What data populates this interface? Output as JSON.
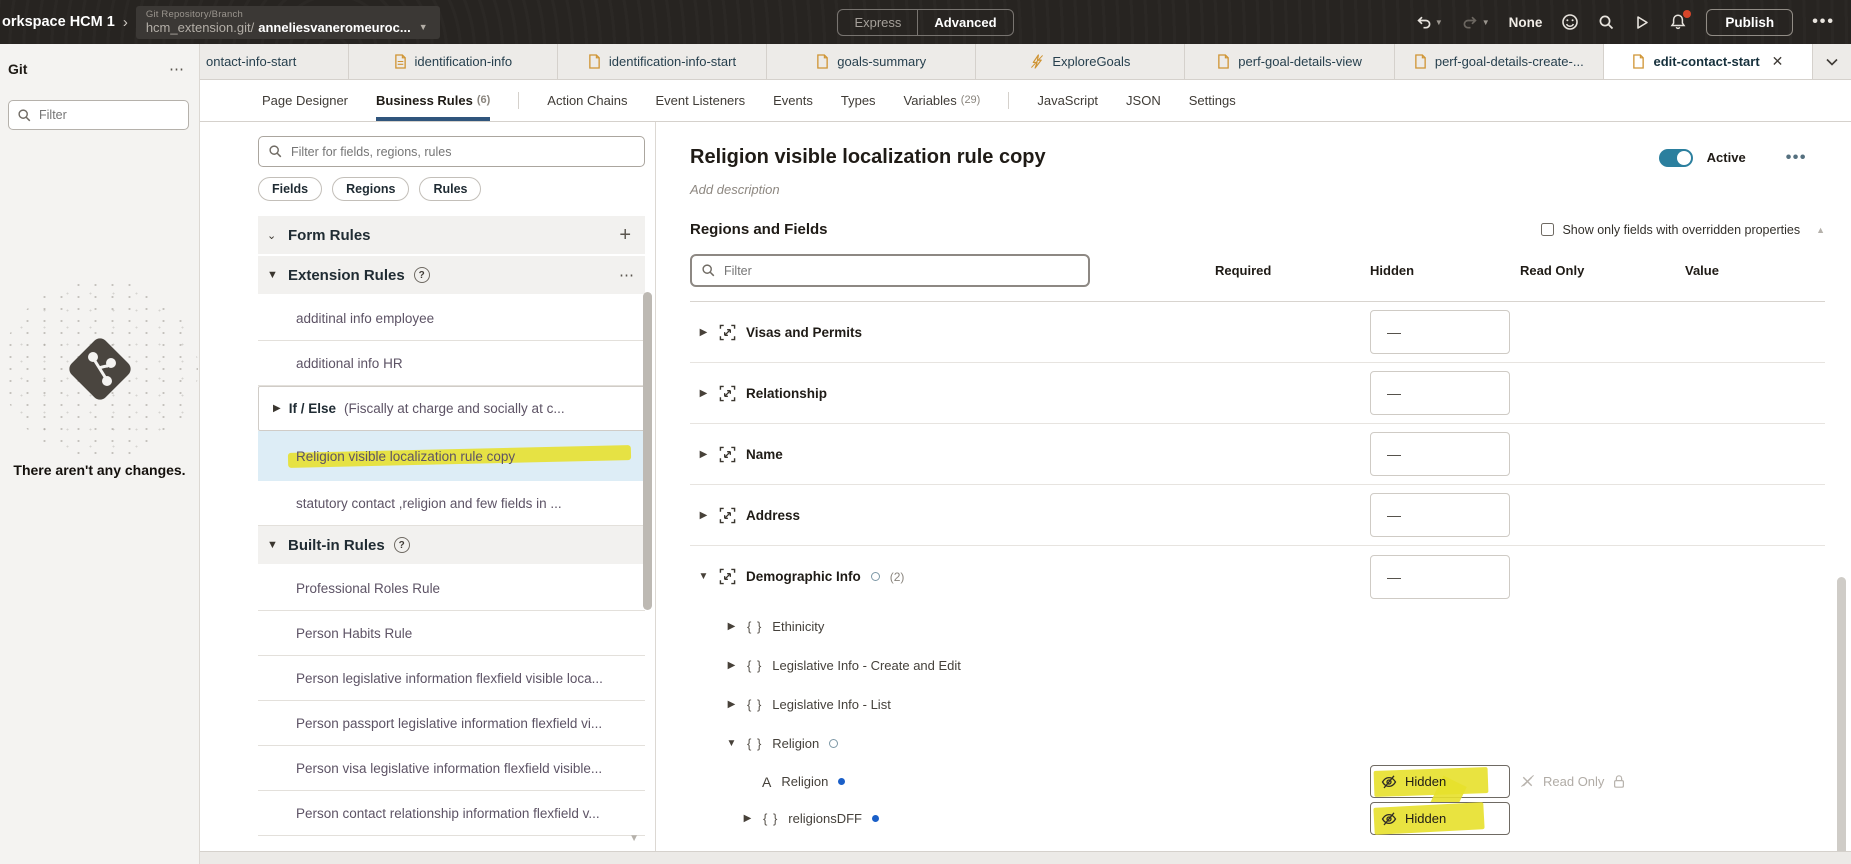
{
  "colors": {
    "accent_teal": "#2b7f9e",
    "highlight_yellow": "#e7e02b",
    "tab_icon_orange": "#cf9433",
    "selected_row_blue": "#ddedf6",
    "notification_red": "#d6452a",
    "field_dot_blue": "#1a5fc8"
  },
  "topbar": {
    "workspace": "orkspace HCM 1",
    "git_label": "Git Repository/Branch",
    "git_repo": "hcm_extension.git/",
    "git_branch": "anneliesvaneromeuroc...",
    "express": "Express",
    "advanced": "Advanced",
    "history_value": "None",
    "publish": "Publish"
  },
  "tabs": [
    {
      "label": "ontact-info-start"
    },
    {
      "label": "identification-info"
    },
    {
      "label": "identification-info-start"
    },
    {
      "label": "goals-summary"
    },
    {
      "label": "ExploreGoals"
    },
    {
      "label": "perf-goal-details-view"
    },
    {
      "label": "perf-goal-details-create-..."
    },
    {
      "label": "edit-contact-start"
    }
  ],
  "subtabs": [
    {
      "label": "Page Designer"
    },
    {
      "label": "Business Rules",
      "count": "(6)"
    },
    {
      "label": "Action Chains"
    },
    {
      "label": "Event Listeners"
    },
    {
      "label": "Events"
    },
    {
      "label": "Types"
    },
    {
      "label": "Variables",
      "count": "(29)"
    },
    {
      "label": "JavaScript"
    },
    {
      "label": "JSON"
    },
    {
      "label": "Settings"
    }
  ],
  "git_panel": {
    "title": "Git",
    "filter_placeholder": "Filter",
    "empty_message": "There aren't any changes."
  },
  "rules_panel": {
    "filter_placeholder": "Filter for fields, regions, rules",
    "chips": [
      "Fields",
      "Regions",
      "Rules"
    ],
    "form_rules_title": "Form Rules",
    "extension_rules_title": "Extension Rules",
    "builtin_rules_title": "Built-in Rules",
    "item_1": "additinal info employee",
    "item_2": "additional info HR",
    "if_else": {
      "bold": "If / Else",
      "rest": "(Fiscally at charge and socially at c..."
    },
    "selected_item": "Religion visible localization rule copy",
    "item_5": "statutory contact ,religion and few fields in ...",
    "builtin_items": [
      "Professional Roles Rule",
      "Person Habits Rule",
      "Person legislative information flexfield visible loca...",
      "Person passport legislative information flexfield vi...",
      "Person visa legislative information flexfield visible...",
      "Person contact relationship information flexfield v..."
    ]
  },
  "rule_editor": {
    "title": "Religion visible localization rule copy",
    "description_placeholder": "Add description",
    "active_label": "Active",
    "section_title": "Regions and Fields",
    "overridden_label": "Show only fields with overridden properties",
    "filter_placeholder": "Filter",
    "columns": [
      "Required",
      "Hidden",
      "Read Only",
      "Value"
    ],
    "rows": [
      {
        "label": "Visas and Permits",
        "hidden_value": "—"
      },
      {
        "label": "Relationship",
        "hidden_value": "—"
      },
      {
        "label": "Name",
        "hidden_value": "—"
      },
      {
        "label": "Address",
        "hidden_value": "—"
      },
      {
        "label": "Demographic Info",
        "count": "(2)",
        "hidden_value": "—"
      },
      {
        "label": "Ethinicity"
      },
      {
        "label": "Legislative Info - Create and Edit"
      },
      {
        "label": "Legislative Info - List"
      },
      {
        "label": "Religion"
      },
      {
        "label": "Religion",
        "hidden_label": "Hidden",
        "readonly_label": "Read Only"
      },
      {
        "label": "religionsDFF",
        "hidden_label": "Hidden"
      }
    ]
  }
}
